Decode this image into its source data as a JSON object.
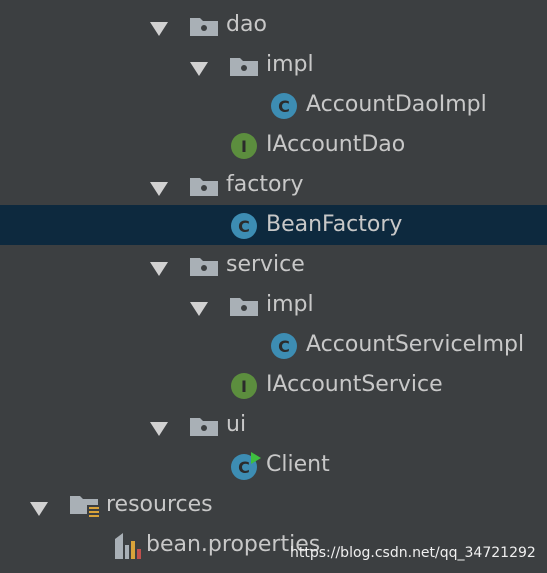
{
  "tree": {
    "items": [
      {
        "label": "dao",
        "kind": "package",
        "icon": "package-folder-icon",
        "expanded": true
      },
      {
        "label": "impl",
        "kind": "package",
        "icon": "package-folder-icon",
        "expanded": true
      },
      {
        "label": "AccountDaoImpl",
        "kind": "class",
        "icon": "class-icon"
      },
      {
        "label": "IAccountDao",
        "kind": "interface",
        "icon": "interface-icon"
      },
      {
        "label": "factory",
        "kind": "package",
        "icon": "package-folder-icon",
        "expanded": true
      },
      {
        "label": "BeanFactory",
        "kind": "class",
        "icon": "class-icon",
        "selected": true
      },
      {
        "label": "service",
        "kind": "package",
        "icon": "package-folder-icon",
        "expanded": true
      },
      {
        "label": "impl",
        "kind": "package",
        "icon": "package-folder-icon",
        "expanded": true
      },
      {
        "label": "AccountServiceImpl",
        "kind": "class",
        "icon": "class-icon"
      },
      {
        "label": "IAccountService",
        "kind": "interface",
        "icon": "interface-icon"
      },
      {
        "label": "ui",
        "kind": "package",
        "icon": "package-folder-icon",
        "expanded": true
      },
      {
        "label": "Client",
        "kind": "main-class",
        "icon": "runnable-class-icon"
      },
      {
        "label": "resources",
        "kind": "resources-folder",
        "icon": "resources-folder-icon",
        "expanded": true
      },
      {
        "label": "bean.properties",
        "kind": "properties-file",
        "icon": "properties-file-icon"
      }
    ]
  },
  "watermark": "https://blog.csdn.net/qq_34721292",
  "colors": {
    "background": "#3c3f41",
    "selection": "#0d293e",
    "text": "#c8c8c8",
    "class_icon": "#3d8db3",
    "interface_icon": "#5c8e3e",
    "folder_icon": "#a9b0b6"
  }
}
